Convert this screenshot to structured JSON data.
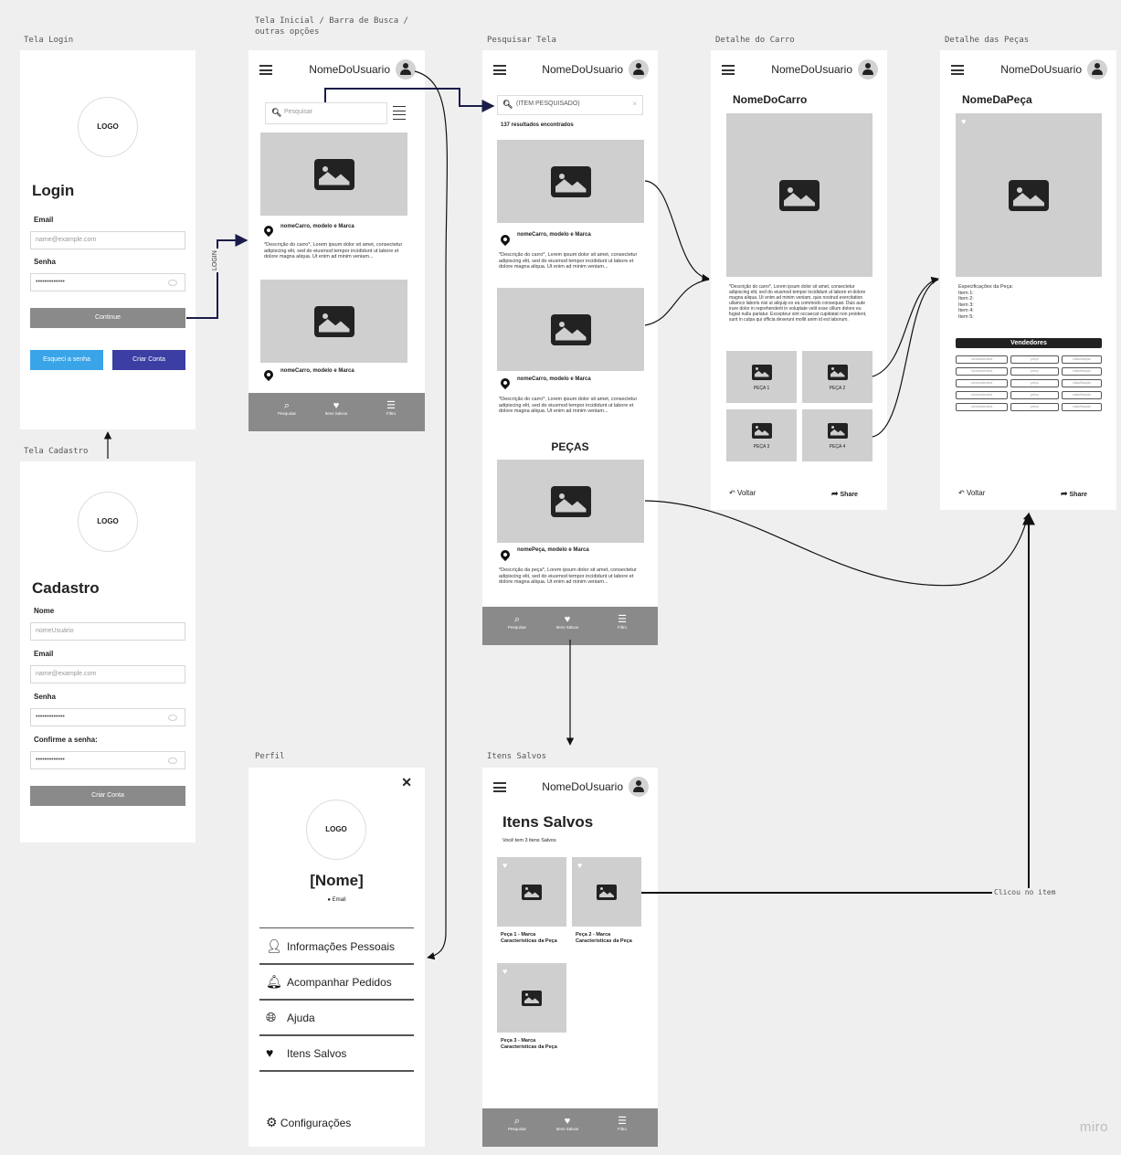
{
  "labels": {
    "login": "Tela Login",
    "home": "Tela Inicial / Barra de Busca /\noutras opções",
    "search": "Pesquisar Tela",
    "car": "Detalhe do Carro",
    "parts": "Detalhe das Peças",
    "cadastro": "Tela Cadastro",
    "perfil": "Perfil",
    "saved": "Itens Salvos"
  },
  "common": {
    "username": "NomeDoUsuario",
    "logo": "LOGO",
    "nav_search": "Pesquisar",
    "nav_saved": "Itens Salvos",
    "nav_filter": "Filtro",
    "back": "Voltar",
    "share": "Share",
    "watermark": "miro"
  },
  "login": {
    "title": "Login",
    "email_label": "Email",
    "email_placeholder": "name@example.com",
    "password_label": "Senha",
    "password_value": "•••••••••••••",
    "continue": "Continue",
    "forgot": "Esqueci a senha",
    "create": "Criar Conta"
  },
  "cadastro": {
    "title": "Cadastro",
    "name_label": "Nome",
    "name_placeholder": "nomeUsuário",
    "email_label": "Email",
    "email_placeholder": "name@example.com",
    "password_label": "Senha",
    "password_value": "•••••••••••••",
    "confirm_label": "Confirme a senha:",
    "confirm_value": "•••••••••••••",
    "create": "Criar Conta"
  },
  "home": {
    "search_placeholder": "Pesquisar",
    "card_title": "nomeCarro, modelo e Marca",
    "card_desc": "*Descrição do carro*, Lorem ipsum dolor sit amet, consectetur adipiscing elit, sed do eiusmod tempor incididunt ut labore et dolore magna aliqua. Ut enim ad minim veniam..."
  },
  "search": {
    "query": "(ITEM PESQUISADO)",
    "results": "137 resultados encontrados",
    "card_title": "nomeCarro, modelo e Marca",
    "card_desc": "*Descrição do carro*, Lorem ipsum dolor sit amet, consectetur adipiscing elit, sed do eiusmod tempor incididunt ut labore et dolore magna aliqua. Ut enim ad minim veniam...",
    "parts_heading": "PEÇAS",
    "part_title": "nomePeça, modelo e Marca",
    "part_desc": "*Descrição da peça*, Lorem ipsum dolor sit amet, consectetur adipiscing elit, sed do eiusmod tempor incididunt ut labore et dolore magna aliqua. Ut enim ad minim veniam..."
  },
  "car": {
    "name": "NomeDoCarro",
    "desc": "*Descrição do carro*, Lorem ipsum dolor sit amet, consectetur adipiscing elit, sed do eiusmod tempor incididunt ut labore et dolore magna aliqua. Ut enim ad minim veniam, quis nostrud exercitation ullamco laboris nisi ut aliquip ex ea commodo consequat. Duis aute irure dolor in reprehenderit in voluptate velit esse cillum dolore eu fugiat nulla pariatur. Excepteur sint occaecat cupidatat non proident, sunt in culpa qui officia deserunt mollit anim id est laborum.",
    "parts": [
      "PEÇA 1",
      "PEÇA 2",
      "PEÇA 3",
      "PEÇA 4"
    ]
  },
  "part": {
    "name": "NomeDaPeça",
    "specs": "Especificações da Peça:\nItem 1:\nItem 2:\nItem 3:\nItem 4:\nItem 5:",
    "sellers": "Vendedores",
    "seller_cells": [
      "concessionária",
      "preço",
      "classificação"
    ]
  },
  "perfil": {
    "name": "[Nome]",
    "email": "Email",
    "menu": [
      "Informações Pessoais",
      "Acompanhar Pedidos",
      "Ajuda",
      "Itens Salvos"
    ],
    "settings": "Configurações"
  },
  "saved": {
    "title": "Itens Salvos",
    "count": "Você tem 3 itens Salvos",
    "items": [
      "Peça 1 - Marca Características da Peça",
      "Peça 2 - Marca Características da Peça",
      "Peça 3 - Marca Características da Peça"
    ]
  },
  "connectors": {
    "login": "LOGIN",
    "clicked": "Clicou no item"
  }
}
